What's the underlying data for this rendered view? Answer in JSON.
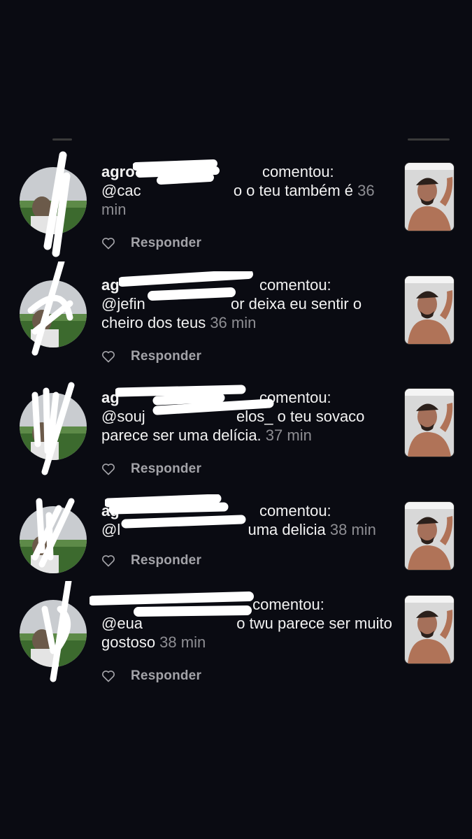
{
  "notifications": [
    {
      "username": "agro",
      "verb": "comentou:",
      "message_head": "@cac",
      "message_tail": "o o teu também é ",
      "time": "36 min",
      "reply_label": "Responder"
    },
    {
      "username": "ag",
      "verb": "comentou:",
      "message_head": "@jefin",
      "message_tail": "or deixa eu sentir o cheiro dos teus ",
      "time": "36 min",
      "reply_label": "Responder"
    },
    {
      "username": "ag",
      "verb": "comentou:",
      "message_head": "@souj",
      "message_tail": "elos_ o teu sovaco parece ser uma delícia. ",
      "time": "37 min",
      "reply_label": "Responder"
    },
    {
      "username": "ag",
      "verb": "comentou:",
      "message_head": "@l",
      "message_tail": "uma delicia ",
      "time": "38 min",
      "reply_label": "Responder"
    },
    {
      "username": "",
      "verb": "comentou:",
      "message_head": "@eua",
      "message_tail": "o twu parece ser muito gostoso ",
      "time": "38 min",
      "reply_label": "Responder"
    }
  ],
  "icons": {
    "like": "heart-outline-icon"
  },
  "colors": {
    "background": "#0a0b12",
    "text": "#f2f2f2",
    "muted": "#8e8e93",
    "reply": "#a3a3a8"
  }
}
